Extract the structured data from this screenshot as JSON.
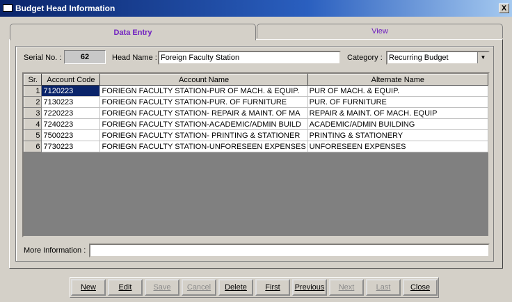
{
  "window": {
    "title": "Budget Head Information",
    "close_glyph": "X"
  },
  "tabs": [
    {
      "label": "Data Entry"
    },
    {
      "label": "View"
    }
  ],
  "form": {
    "serial_label": "Serial No. :",
    "serial_value": "62",
    "head_name_label": "Head Name :",
    "head_name_value": "Foreign Faculty Station",
    "category_label": "Category :",
    "category_value": "Recurring Budget",
    "more_info_label": "More Information :",
    "more_info_value": ""
  },
  "grid": {
    "columns": [
      "Sr.",
      "Account Code",
      "Account Name",
      "Alternate Name"
    ],
    "rows": [
      {
        "sr": "1",
        "code": "7120223",
        "name": "FORIEGN FACULTY STATION-PUR OF MACH. & EQUIP.",
        "alt": "PUR OF MACH. & EQUIP."
      },
      {
        "sr": "2",
        "code": "7130223",
        "name": "FORIEGN FACULTY STATION-PUR. OF FURNITURE",
        "alt": "PUR. OF FURNITURE"
      },
      {
        "sr": "3",
        "code": "7220223",
        "name": "FORIEGN FACULTY STATION- REPAIR & MAINT. OF MA",
        "alt": "REPAIR & MAINT. OF MACH. EQUIP"
      },
      {
        "sr": "4",
        "code": "7240223",
        "name": "FORIEGN FACULTY STATION-ACADEMIC/ADMIN BUILD",
        "alt": "ACADEMIC/ADMIN BUILDING"
      },
      {
        "sr": "5",
        "code": "7500223",
        "name": "FORIEGN FACULTY STATION- PRINTING & STATIONER",
        "alt": "PRINTING & STATIONERY"
      },
      {
        "sr": "6",
        "code": "7730223",
        "name": "FORIEGN FACULTY STATION-UNFORESEEN EXPENSES",
        "alt": "UNFORESEEN EXPENSES"
      }
    ]
  },
  "buttons": {
    "new": "New",
    "edit": "Edit",
    "save": "Save",
    "cancel": "Cancel",
    "delete": "Delete",
    "first": "First",
    "previous": "Previous",
    "next": "Next",
    "last": "Last",
    "close": "Close"
  },
  "icons": {
    "window": "window-icon",
    "dropdown": "chevron-down-icon"
  },
  "colors": {
    "title_bar": "#0a246a",
    "tab_text": "#7020c0",
    "selection": "#0a246a",
    "grid_bg": "#808080"
  }
}
